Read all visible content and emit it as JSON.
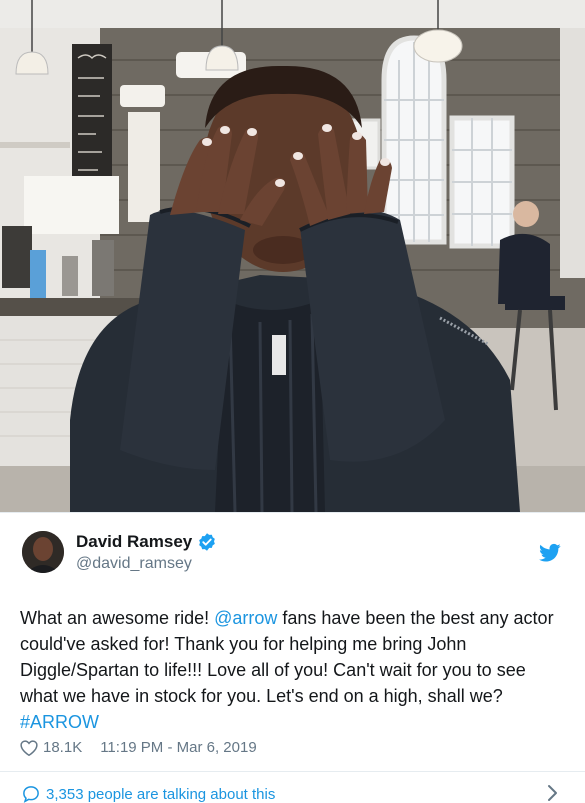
{
  "photo": {
    "alt": ""
  },
  "author": {
    "display_name": "David Ramsey",
    "handle": "@david_ramsey",
    "verified": true
  },
  "tweet": {
    "part1": "What an awesome ride!  ",
    "mention": "@arrow",
    "part2": " fans have been the best any actor could've asked for! Thank you for helping me bring John Diggle/Spartan to life!!! Love all of you! Can't wait for you to see what we have in stock for you. Let's end on a high, shall we?",
    "hashtag": "#ARROW"
  },
  "meta": {
    "likes": "18.1K",
    "time": "11:19 PM - Mar 6, 2019"
  },
  "conversation": {
    "label": "3,353 people are talking about this"
  },
  "colors": {
    "link": "#1b95e0",
    "text": "#14171a",
    "muted": "#657786",
    "twitter": "#1da1f2"
  },
  "icons": [
    "verified-badge-icon",
    "twitter-bird-icon",
    "heart-icon",
    "speech-bubble-icon",
    "chevron-right-icon"
  ]
}
